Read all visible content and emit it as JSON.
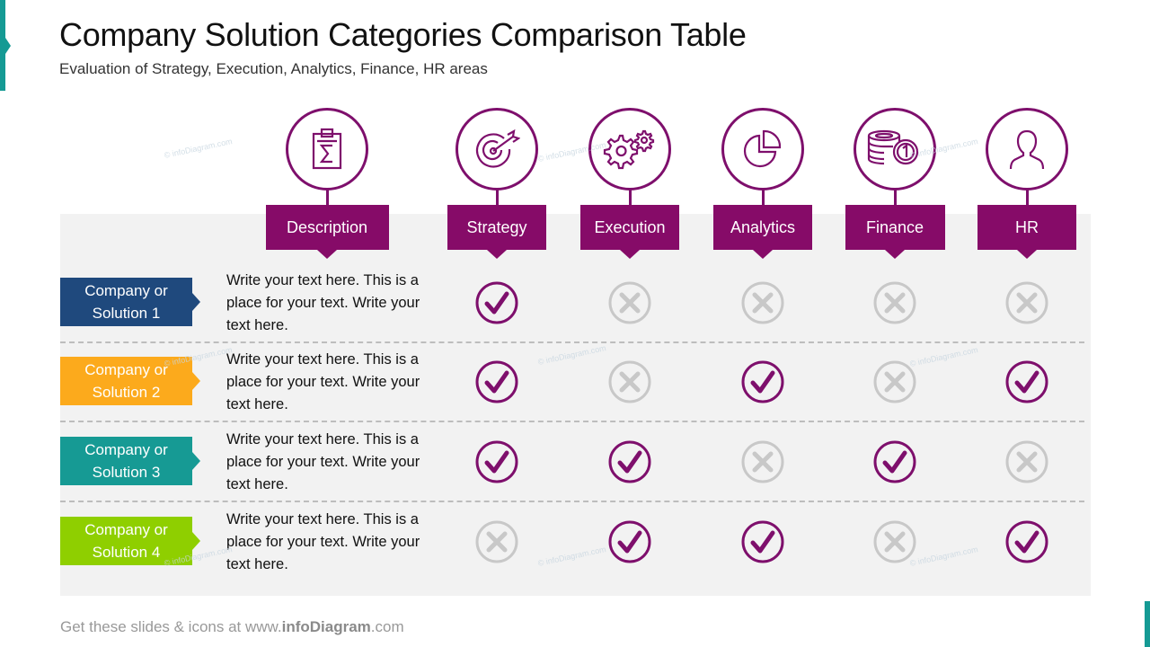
{
  "header": {
    "title": "Company Solution Categories Comparison Table",
    "subtitle": "Evaluation of Strategy, Execution,  Analytics, Finance, HR areas"
  },
  "columns": [
    {
      "key": "description",
      "label": "Description",
      "icon": "clipboard-sigma-icon"
    },
    {
      "key": "strategy",
      "label": "Strategy",
      "icon": "target-arrow-icon"
    },
    {
      "key": "execution",
      "label": "Execution",
      "icon": "gears-icon"
    },
    {
      "key": "analytics",
      "label": "Analytics",
      "icon": "pie-chart-icon"
    },
    {
      "key": "finance",
      "label": "Finance",
      "icon": "coins-icon"
    },
    {
      "key": "hr",
      "label": "HR",
      "icon": "person-icon"
    }
  ],
  "rows": [
    {
      "label_line1": "Company or",
      "label_line2": "Solution 1",
      "color": "#1f497d",
      "description": "Write your text here. This is a place for your text. Write your text here.",
      "values": {
        "strategy": true,
        "execution": false,
        "analytics": false,
        "finance": false,
        "hr": false
      }
    },
    {
      "label_line1": "Company or",
      "label_line2": "Solution 2",
      "color": "#fcaa1c",
      "description": "Write your text here. This is a place for your text. Write your text here.",
      "values": {
        "strategy": true,
        "execution": false,
        "analytics": true,
        "finance": false,
        "hr": true
      }
    },
    {
      "label_line1": "Company or",
      "label_line2": "Solution 3",
      "color": "#169a94",
      "description": "Write your text here. This is a place for your text. Write your text here.",
      "values": {
        "strategy": true,
        "execution": true,
        "analytics": false,
        "finance": true,
        "hr": false
      }
    },
    {
      "label_line1": "Company or",
      "label_line2": "Solution 4",
      "color": "#8fcf00",
      "description": "Write your text here. This is a place for your text. Write your text here.",
      "values": {
        "strategy": false,
        "execution": true,
        "analytics": true,
        "finance": false,
        "hr": true
      }
    }
  ],
  "colors": {
    "accent": "#7e0f6c",
    "tab": "#860b68",
    "cross": "#c8c8c8",
    "teal": "#159a94"
  },
  "watermark": "© infoDiagram.com",
  "footer": {
    "prefix": "Get these slides & icons at www.",
    "brand": "infoDiagram",
    "suffix": ".com"
  }
}
